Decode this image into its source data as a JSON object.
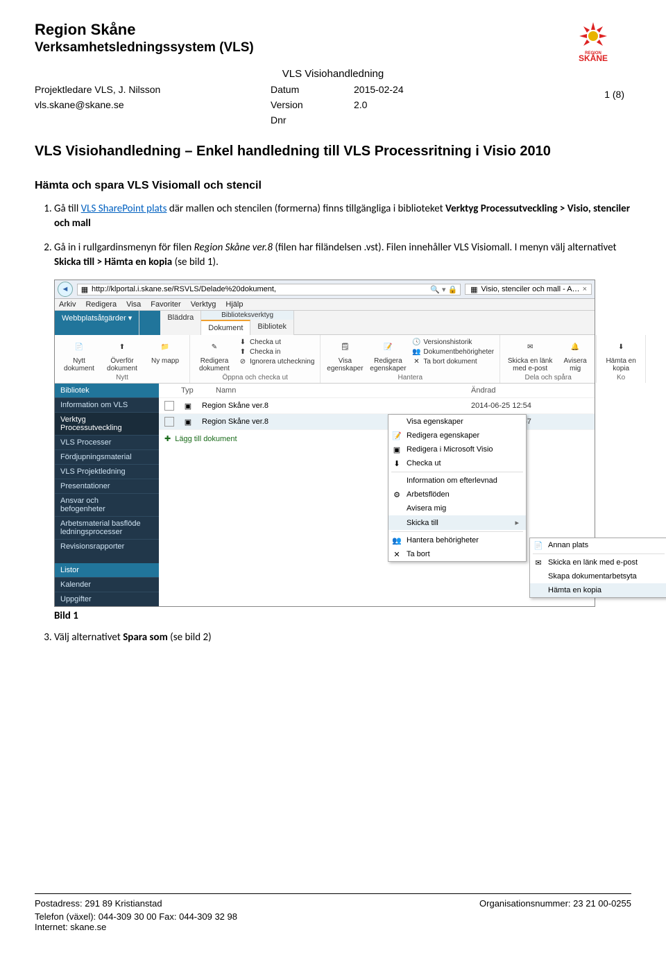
{
  "header": {
    "org_title": "Region Skåne",
    "org_sub": "Verksamhetsledningssystem (VLS)",
    "doc_title": "VLS Visiohandledning",
    "author_line": "Projektledare VLS, J. Nilsson",
    "email": "vls.skane@skane.se",
    "date_label": "Datum",
    "date_value": "2015-02-24",
    "version_label": "Version",
    "version_value": "2.0",
    "dnr_label": "Dnr",
    "page_num": "1 (8)",
    "logo_text": "SKÅNE",
    "logo_small": "REGION"
  },
  "main": {
    "title": "VLS Visiohandledning – Enkel handledning till VLS Processritning i Visio 2010",
    "section1": "Hämta och spara VLS Visiomall och stencil",
    "steps": {
      "s1_pre": "Gå till ",
      "s1_link": "VLS SharePoint plats",
      "s1_post": " där mallen och stencilen (formerna) finns tillgängliga i biblioteket ",
      "s1_bold": "Verktyg Processutveckling > Visio, stenciler och mall",
      "s2_pre": "Gå in i rullgardinsmenyn för filen ",
      "s2_italic": "Region Skåne ver.8",
      "s2_mid": " (filen har filändelsen .vst). Filen innehåller VLS Visiomall. I menyn välj alternativet ",
      "s2_bold": "Skicka till > Hämta en kopia",
      "s2_post": " (se bild 1).",
      "s3": "Välj alternativet ",
      "s3_bold": "Spara som",
      "s3_post": " (se bild 2)"
    },
    "caption1": "Bild 1"
  },
  "shot": {
    "url": "http://klportal.i.skane.se/RSVLS/Delade%20dokument,",
    "tab_title": "Visio, stenciler och mall - A…",
    "ie_menu": [
      "Arkiv",
      "Redigera",
      "Visa",
      "Favoriter",
      "Verktyg",
      "Hjälp"
    ],
    "ribbon_tabs": {
      "webb": "Webbplatsåtgärder",
      "bladdra": "Bläddra",
      "biblio_hdr": "Biblioteksverktyg",
      "dokument": "Dokument",
      "bibliotek": "Bibliotek"
    },
    "ribbon": {
      "nytt": "Nytt dokument",
      "overfor": "Överför dokument",
      "nymapp": "Ny mapp",
      "redigera": "Redigera dokument",
      "checka_ut": "Checka ut",
      "checka_in": "Checka in",
      "ignorera": "Ignorera utcheckning",
      "visa_eg": "Visa egenskaper",
      "red_eg": "Redigera egenskaper",
      "versions": "Versionshistorik",
      "dokbeh": "Dokumentbehörigheter",
      "ta_bort": "Ta bort dokument",
      "skicka_lank": "Skicka en länk med e-post",
      "avisera": "Avisera mig",
      "hamta": "Hämta en kopia",
      "group_nytt": "Nytt",
      "group_oppna": "Öppna och checka ut",
      "group_hantera": "Hantera",
      "group_dela": "Dela och spåra",
      "group_ko": "Ko"
    },
    "nav": {
      "bibliotek": "Bibliotek",
      "info": "Information om VLS",
      "verktyg1": "Verktyg",
      "verktyg2": "Processutveckling",
      "proc": "VLS Processer",
      "fordj": "Fördjupningsmaterial",
      "proj": "VLS Projektledning",
      "pres": "Presentationer",
      "ansvar1": "Ansvar och",
      "ansvar2": "befogenheter",
      "arbets1": "Arbetsmaterial basflöde",
      "arbets2": "ledningsprocesser",
      "revis": "Revisionsrapporter",
      "listor": "Listor",
      "kalender": "Kalender",
      "uppg": "Uppgifter"
    },
    "table": {
      "th_type": "Typ",
      "th_name": "Namn",
      "th_mod": "Ändrad",
      "r1_name": "Region Skåne ver.8",
      "r1_mod": "2014-06-25 12:54",
      "r2_name": "Region Skåne ver.8",
      "r2_mod": "2014-06-25 12:57",
      "add": "Lägg till dokument"
    },
    "ctx": {
      "visa": "Visa egenskaper",
      "red": "Redigera egenskaper",
      "red_visio": "Redigera i Microsoft Visio",
      "checka": "Checka ut",
      "info_eft": "Information om efterlevnad",
      "arbets": "Arbetsflöden",
      "avisera": "Avisera mig",
      "skicka": "Skicka till",
      "hantera": "Hantera behörigheter",
      "tabort": "Ta bort"
    },
    "ctx_sub": {
      "annan": "Annan plats",
      "lank": "Skicka en länk med e-post",
      "skapa": "Skapa dokumentarbetsyta",
      "hamta": "Hämta en kopia"
    }
  },
  "footer": {
    "post": "Postadress: 291 89 Kristianstad",
    "orgnr": "Organisationsnummer: 23 21 00-0255",
    "tel": "Telefon (växel): 044-309 30 00   Fax: 044-309 32 98",
    "internet": "Internet: skane.se"
  }
}
